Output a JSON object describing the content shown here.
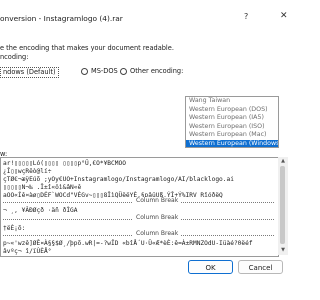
{
  "window": {
    "title": "onversion - Instagramlogo (4).rar",
    "help_glyph": "?",
    "close_glyph": "✕"
  },
  "dialog": {
    "intro": "e the encoding that makes your document readable.",
    "text_encoding_label": "ncoding:",
    "options": {
      "windows_default": "ndows (Default)",
      "msdos": "MS-DOS",
      "other": "Other encoding:"
    },
    "selected_option": "windows_default",
    "encodings": [
      "Wang Taiwan",
      "Western European (DOS)",
      "Western European (IA5)",
      "Western European (ISO)",
      "Western European (Mac)",
      "Western European (Windows)"
    ],
    "selected_encoding_index": 5,
    "preview_label": "w:",
    "preview_lines": [
      "ar!▯▯▯▯▯Ló(▯▯▯▯      ▯▯▯▯p°Ü,€O*¥BCMOO",
      "¿Î▯▯wçRêò@lí÷",
      "çTØ€¬æÿEúõ ;yOy€UO+Instagramlogo/Instagramlogo/AI/blacklogo.ai",
      "▯▯▯▯▯N¬‰ .Î±î«öì&âN«ê",
      "aOO«Íê¤àø▯DÉF`WOCd\"VÉGv~▯▯▯8ÎìQÜëëYÈ,§pâüUß,ÝÎ+Ý%IRV RîóðëQ",
      "",
      "¬ ¸, ¥ÂÐØçð ·äñ  ðÌGA",
      "",
      "",
      "†ëÈ¡õ:",
      "",
      "p~«'wzê]ØÊ¤À§§$Ø¸/þpõ.wR|=-?wÎD «bîÅ´U·Ü«Æ*èÈ:ê=À±RMNZOdU-Iüàé?0ëéf",
      "âvºç¬  î/ïÙÈÅ°"
    ],
    "column_break_label": "Column Break",
    "buttons": {
      "ok": "OK",
      "cancel": "Cancel"
    }
  }
}
